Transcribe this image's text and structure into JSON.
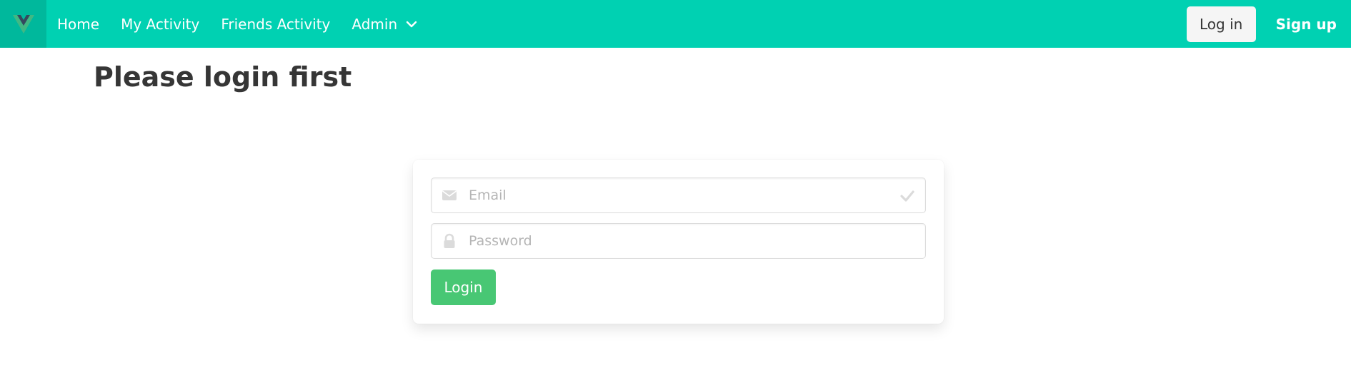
{
  "navbar": {
    "logo_icon": "vue-logo-icon",
    "items": [
      {
        "label": "Home"
      },
      {
        "label": "My Activity"
      },
      {
        "label": "Friends Activity"
      },
      {
        "label": "Admin"
      }
    ],
    "login_label": "Log in",
    "signup_label": "Sign up"
  },
  "page": {
    "title": "Please login first"
  },
  "form": {
    "email_placeholder": "Email",
    "email_value": "",
    "password_placeholder": "Password",
    "password_value": "",
    "submit_label": "Login"
  },
  "colors": {
    "navbar": "#00d1b2",
    "brand_bg": "#00b89c",
    "submit": "#48c774",
    "icon_muted": "#dbdbdb"
  }
}
